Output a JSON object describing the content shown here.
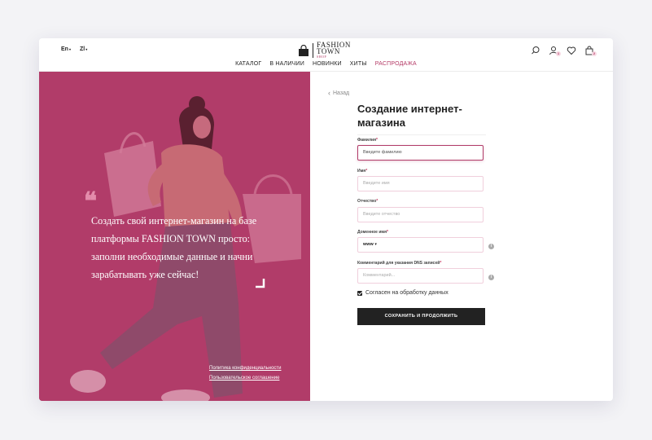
{
  "header": {
    "lang_en": "En",
    "lang_zl": "Zl",
    "logo": {
      "line1": "FASHION",
      "line2": "TOWN",
      "line3": "SHOP"
    },
    "cart_count": "2",
    "user_badge": "1"
  },
  "nav": [
    "КАТАЛОГ",
    "В НАЛИЧИИ",
    "НОВИНКИ",
    "ХИТЫ",
    "РАСПРОДАЖА"
  ],
  "promo": {
    "quote_mark": "❝",
    "text": "Создать свой интернет-магазин на базе платформы FASHION TOWN просто: заполни необходимые данные и начни зарабатывать уже сейчас!",
    "links": [
      "Политика конфиденциальности",
      "Пользовательское соглашение"
    ]
  },
  "form": {
    "back": "Назад",
    "title": "Создание интернет-магазина",
    "fields": [
      {
        "label": "Фамилия",
        "placeholder": "Введите фамилию"
      },
      {
        "label": "Имя",
        "placeholder": "Введите имя"
      },
      {
        "label": "Отчество",
        "placeholder": "Введите отчество"
      },
      {
        "label": "Доменное имя",
        "placeholder": "www"
      },
      {
        "label": "Комментарий для указания DNS записей",
        "placeholder": "Комментарий..."
      }
    ],
    "required_mark": "*",
    "consent": "Согласен на обработку данных",
    "submit": "СОХРАНИТЬ И ПРОДОЛЖИТЬ"
  },
  "colors": {
    "accent": "#b13c69",
    "dark": "#222222"
  }
}
